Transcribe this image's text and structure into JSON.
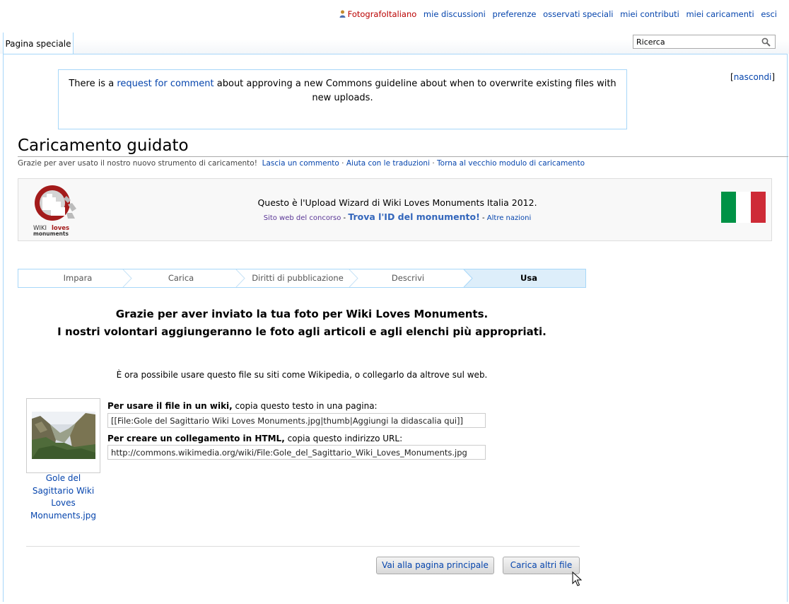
{
  "personal": {
    "user": "FotografoItaliano",
    "items": [
      "mie discussioni",
      "preferenze",
      "osservati speciali",
      "miei contributi",
      "miei caricamenti",
      "esci"
    ]
  },
  "tabs": {
    "special_page": "Pagina speciale"
  },
  "search": {
    "value": "Ricerca"
  },
  "notice": {
    "before": "There is a ",
    "link": "request for comment",
    "after": " about approving a new Commons guideline about when to overwrite existing files with new uploads.",
    "hide_open": "[",
    "hide_link": "nascondi",
    "hide_close": "]"
  },
  "page": {
    "title": "Caricamento guidato",
    "subtitle": "Grazie per aver usato il nostro nuovo strumento di caricamento!",
    "links": [
      "Lascia un commento",
      "Aiuta con le traduzioni",
      "Torna al vecchio modulo di caricamento"
    ],
    "separator": "·"
  },
  "banner": {
    "logo_line1a": "WIKI",
    "logo_line1b": "loves",
    "logo_line2": "monuments",
    "headline": "Questo è l'Upload Wizard di Wiki Loves Monuments Italia 2012.",
    "site_link": "Sito web del concorso",
    "dash": " - ",
    "find_id": "Trova l'ID del monumento!",
    "other_nations": "Altre nazioni",
    "flag_colors": [
      "#009246",
      "#ffffff",
      "#ce2b37"
    ]
  },
  "steps": [
    {
      "label": "Impara",
      "active": false
    },
    {
      "label": "Carica",
      "active": false
    },
    {
      "label": "Diritti di pubblicazione",
      "active": false
    },
    {
      "label": "Descrivi",
      "active": false
    },
    {
      "label": "Usa",
      "active": true
    }
  ],
  "thanks": {
    "line1": "Grazie per aver inviato la tua foto per Wiki Loves Monuments.",
    "line2": "I nostri volontari aggiungeranno le foto agli articoli e agli elenchi più appropriati."
  },
  "info": "È ora possibile usare questo file su siti come Wikipedia, o collegarlo da altrove sul web.",
  "file": {
    "caption": "Gole del Sagittario Wiki Loves Monuments.jpg",
    "wiki_label_bold": "Per usare il file in un wiki,",
    "wiki_label_rest": " copia questo testo in una pagina:",
    "wiki_value": "[[File:Gole del Sagittario Wiki Loves Monuments.jpg|thumb|Aggiungi la didascalia qui]]",
    "html_label_bold": "Per creare un collegamento in HTML,",
    "html_label_rest": " copia questo indirizzo URL:",
    "html_value": "http://commons.wikimedia.org/wiki/File:Gole_del_Sagittario_Wiki_Loves_Monuments.jpg"
  },
  "buttons": {
    "main_page": "Vai alla pagina principale",
    "more_files": "Carica altri file"
  },
  "colors": {
    "link": "#0645ad",
    "user": "#ba0000",
    "border": "#a7d7f9",
    "active_step": "#ddeefa"
  }
}
